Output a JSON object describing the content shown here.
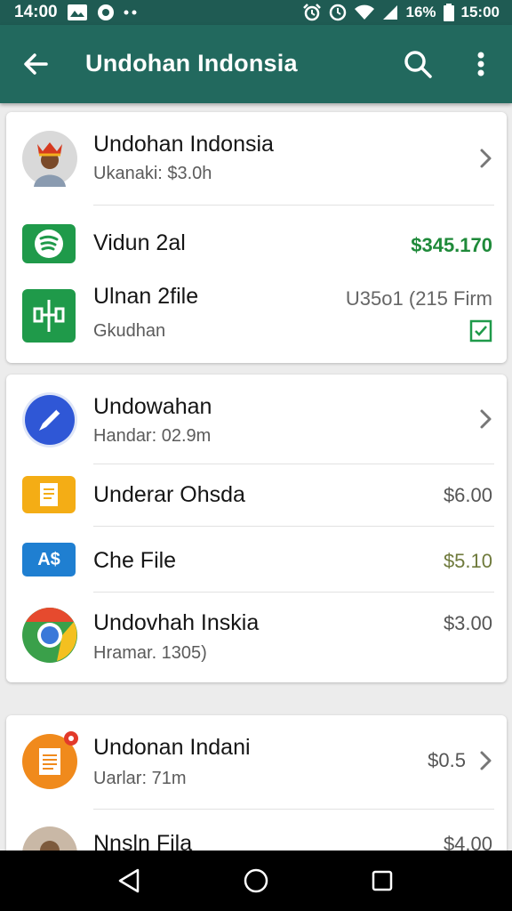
{
  "status_bar": {
    "time_left": "14:00",
    "battery": "16%",
    "time_right": "15:00"
  },
  "app_bar": {
    "title": "Undohan Indonsia",
    "back_icon": "arrow-back-icon",
    "search_icon": "search-icon",
    "menu_icon": "more-vert-icon"
  },
  "cards": [
    {
      "items": [
        {
          "title": "Undohan Indonsia",
          "subtitle": "Ukanaki: $3.0h",
          "icon": "avatar-king"
        },
        {
          "title": "Vidun 2al",
          "amount": "$345.170",
          "amount_color": "#1f8a3a",
          "icon": "spotify-icon"
        },
        {
          "title": "Ulnan 2file",
          "subtitle": "Gkudhan",
          "amount": "U35o1 (215 Firm",
          "icon": "document-app-icon",
          "checked": true
        }
      ]
    },
    {
      "items": [
        {
          "title": "Undowahan",
          "subtitle": "Handar: 02.9m",
          "icon": "edit-pen-icon"
        },
        {
          "title": "Underar Ohsda",
          "amount": "$6.00",
          "icon": "notes-icon"
        },
        {
          "title": "Che File",
          "amount": "$5.10",
          "amount_color": "#6f7a3c",
          "icon": "translate-icon",
          "icon_text": "A$"
        },
        {
          "title": "Undovhah Inskia",
          "subtitle": "Hramar. 1305)",
          "amount": "$3.00",
          "icon": "chrome-icon"
        }
      ]
    },
    {
      "items": [
        {
          "title": "Undonan Indani",
          "subtitle": "Uarlar: 71m",
          "amount": "$0.5",
          "icon": "file-notification-icon"
        },
        {
          "title": "Nnsln Fila",
          "amount": "$4.00",
          "icon": "avatar-generic"
        }
      ]
    }
  ],
  "nav_bar": {
    "back": "nav-back-icon",
    "home": "nav-home-icon",
    "recents": "nav-recents-icon"
  },
  "colors": {
    "app_bar": "#22695e",
    "status_bar": "#1f5b53",
    "accent_green": "#1f8a3a"
  }
}
